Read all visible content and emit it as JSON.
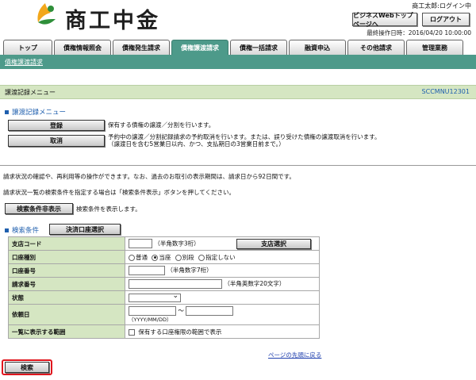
{
  "header": {
    "brand": "商工中金",
    "user_status": "商工太郎:ログイン中",
    "bizweb_top_button": "ビジネスWebトップページへ",
    "logout_button": "ログアウト",
    "last_operation": "最終操作日時：2016/04/20 10:00:00"
  },
  "nav": {
    "tabs": [
      {
        "label": "トップ"
      },
      {
        "label": "債権情報照会"
      },
      {
        "label": "債権発生請求"
      },
      {
        "label": "債権譲渡請求"
      },
      {
        "label": "債権一括請求"
      },
      {
        "label": "融資申込"
      },
      {
        "label": "その他請求"
      },
      {
        "label": "管理業務"
      }
    ],
    "breadcrumb": "債権譲渡請求"
  },
  "page": {
    "title": "譲渡記録メニュー",
    "code": "SCCMNU12301"
  },
  "menu_section": {
    "heading": "譲渡記録メニュー",
    "register_button": "登録",
    "register_desc": "保有する債権の譲渡／分割を行います。",
    "cancel_button": "取消",
    "cancel_desc_1": "予約中の譲渡／分割記録請求の予約取消を行います。または、誤り受けた債権の譲渡取消を行います。",
    "cancel_desc_2": "（譲渡日を含む5営業日以内、かつ、支払期日の3営業日前まで。）"
  },
  "info": {
    "line1": "請求状況の確認や、再利用等の操作ができます。なお、過去のお取引の表示期間は、請求日から92日間です。",
    "line2": "請求状況一覧の検索条件を指定する場合は「検索条件表示」ボタンを押してください。",
    "toggle_button": "検索条件非表示",
    "toggle_desc": "検索条件を表示します。"
  },
  "search": {
    "heading": "検索条件",
    "account_select_button": "決済口座選択",
    "rows": {
      "branch_code": {
        "label": "支店コード",
        "hint": "（半角数字3桁）",
        "button": "支店選択"
      },
      "account_type": {
        "label": "口座種別",
        "options": [
          "普通",
          "当座",
          "別段",
          "指定しない"
        ],
        "selected": "当座"
      },
      "account_number": {
        "label": "口座番号",
        "hint": "（半角数字7桁）"
      },
      "request_number": {
        "label": "請求番号",
        "hint": "（半角英数字20文字）"
      },
      "status": {
        "label": "状態",
        "value": ""
      },
      "request_date": {
        "label": "依頼日",
        "separator": "～",
        "hint": "（YYYY/MM/DD）"
      },
      "display_scope": {
        "label": "一覧に表示する範囲",
        "checkbox_label": "保有する口座権限の範囲で表示"
      }
    },
    "page_top_link": "ページの先頭に戻る",
    "search_button": "検索"
  },
  "colors": {
    "nav_active": "#4d9a8a",
    "section_blue": "#1f5fae",
    "label_bg": "#d5e6c2",
    "highlight_red": "#e0151d"
  },
  "icons": {
    "logo": "shokochukin-logo-icon",
    "section_marker": "square-bullet-icon"
  }
}
